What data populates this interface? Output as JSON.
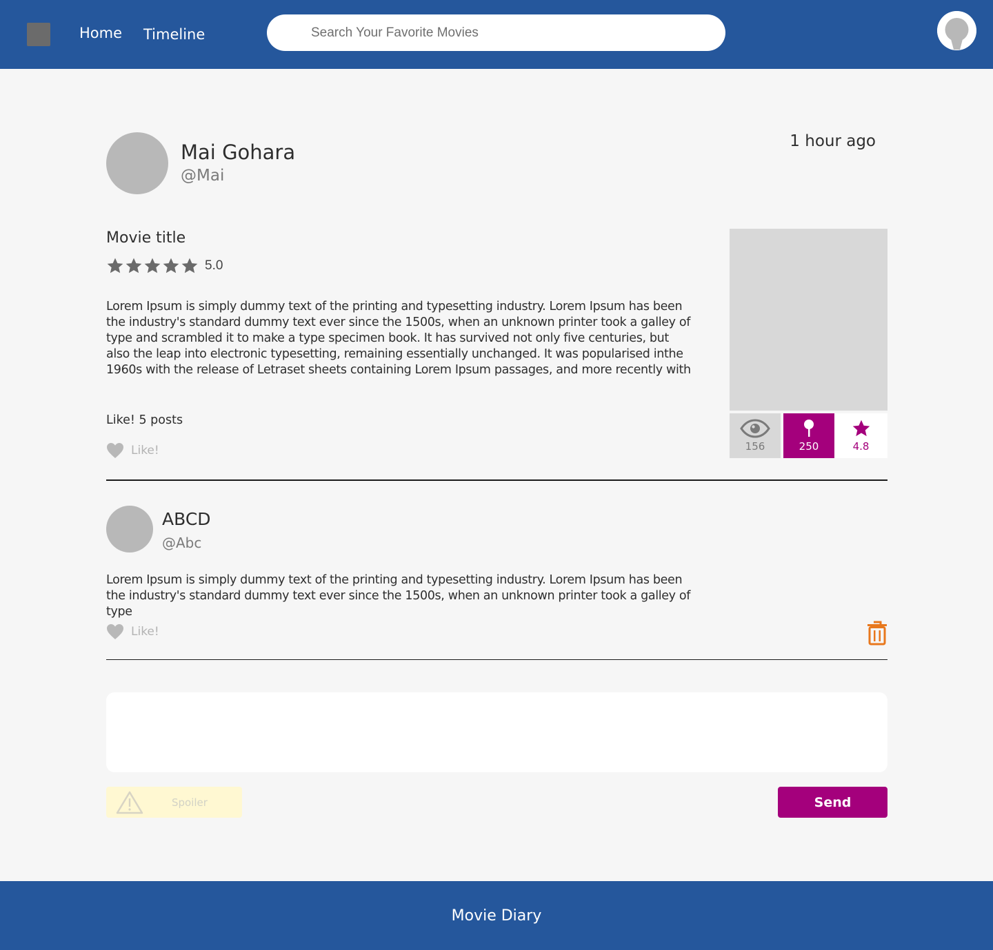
{
  "header": {
    "nav": {
      "home": "Home",
      "timeline": "Timeline"
    },
    "search_placeholder": "Search Your Favorite Movies"
  },
  "post": {
    "author_name": "Mai Gohara",
    "author_handle": "@Mai",
    "time": "1 hour ago",
    "movie_title": "Movie title",
    "rating": "5.0",
    "rating_stars": 5,
    "review": "Lorem Ipsum is simply dummy text of the printing and typesetting industry. Lorem Ipsum has been the industry's standard dummy text ever since the 1500s, when an unknown printer took a galley of type and scrambled it to make a type specimen book. It has survived not only five centuries, but also the leap into electronic typesetting, remaining essentially unchanged. It was popularised inthe 1960s with the release of Letraset sheets containing Lorem Ipsum passages, and more recently with",
    "like_count": "Like! 5 posts",
    "like_label": "Like!",
    "stats": {
      "views": "156",
      "pins": "250",
      "score": "4.8"
    }
  },
  "comment": {
    "author_name": "ABCD",
    "author_handle": "@Abc",
    "text": "Lorem Ipsum is simply dummy text of the printing and typesetting industry. Lorem Ipsum has been the industry's standard dummy text ever since the 1500s, when an unknown printer took a galley of type",
    "like_label": "Like!"
  },
  "compose": {
    "value": "",
    "spoiler_label": "Spoiler",
    "send_label": "Send"
  },
  "footer": {
    "title": "Movie Diary"
  },
  "colors": {
    "header_bg": "#25579c",
    "accent": "#a4007c",
    "delete": "#e8781d",
    "spoiler_bg": "#fff8d2"
  },
  "icons": [
    "user-avatar-icon",
    "star-icon",
    "heart-icon",
    "eye-icon",
    "pin-icon",
    "trash-icon",
    "warning-icon"
  ]
}
